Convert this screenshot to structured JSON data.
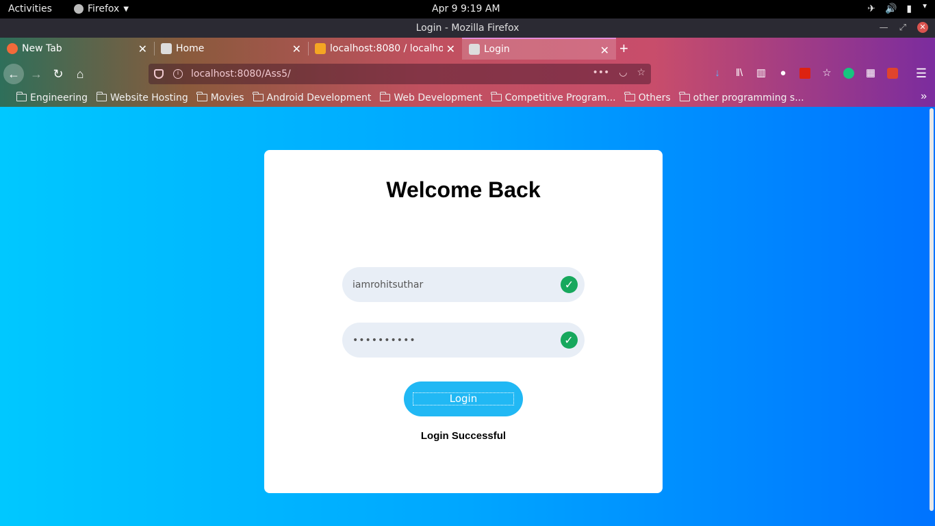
{
  "system": {
    "activities": "Activities",
    "app_name": "Firefox",
    "clock": "Apr 9   9:19 AM"
  },
  "window": {
    "title": "Login - Mozilla Firefox"
  },
  "tabs": [
    {
      "label": "New Tab"
    },
    {
      "label": "Home"
    },
    {
      "label": "localhost:8080 / localho"
    },
    {
      "label": "Login"
    }
  ],
  "urlbar": {
    "url": "localhost:8080/Ass5/"
  },
  "bookmarks": [
    {
      "label": "Engineering"
    },
    {
      "label": "Website Hosting"
    },
    {
      "label": "Movies"
    },
    {
      "label": "Android Development"
    },
    {
      "label": "Web Development"
    },
    {
      "label": "Competitive Program..."
    },
    {
      "label": "Others"
    },
    {
      "label": "other programming s..."
    }
  ],
  "login": {
    "heading": "Welcome Back",
    "username_value": "iamrohitsuthar",
    "password_value": "••••••••••",
    "button_label": "Login",
    "status_text": "Login Successful"
  },
  "colors": {
    "page_gradient_start": "#00c8ff",
    "page_gradient_end": "#0073ff",
    "button": "#21b8f4",
    "field_bg": "#e8eef6",
    "check": "#17a85d"
  }
}
